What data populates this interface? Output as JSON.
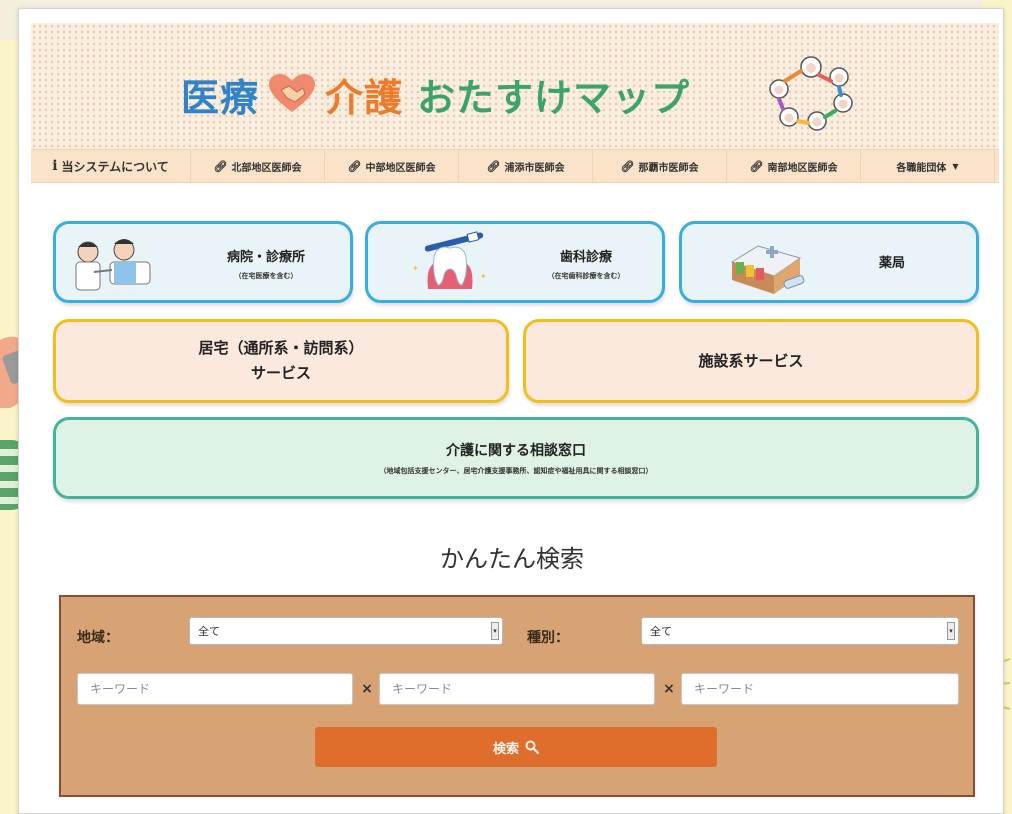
{
  "header": {
    "title_part1": "医療",
    "title_part2": "介護",
    "title_part3": "おたすけマップ"
  },
  "nav": {
    "about": "当システムについて",
    "associations": [
      "北部地区医師会",
      "中部地区医師会",
      "浦添市医師会",
      "那覇市医師会",
      "南部地区医師会"
    ],
    "dropdown": "各職能団体"
  },
  "cards": {
    "hospital": {
      "title": "病院・診療所",
      "sub": "（在宅医療を含む）"
    },
    "dental": {
      "title": "歯科診療",
      "sub": "（在宅歯科診療を含む）"
    },
    "pharmacy": {
      "title": "薬局"
    },
    "home_care": {
      "line1": "居宅（通所系・訪問系）",
      "line2": "サービス"
    },
    "facility": {
      "title": "施設系サービス"
    },
    "consult": {
      "title": "介護に関する相談窓口",
      "sub": "（地域包括支援センター、居宅介護支援事務所、認知症や福祉用具に関する相談窓口）"
    }
  },
  "search": {
    "heading": "かんたん検索",
    "region_label": "地域：",
    "region_value": "全て",
    "type_label": "種別：",
    "type_value": "全て",
    "keyword_placeholder": "キーワード",
    "button_label": "検索"
  },
  "colors": {
    "blue_border": "#35aee3",
    "yellow_border": "#f1bf1c",
    "green_border": "#43b39a",
    "search_panel": "#d8a374",
    "search_button": "#df6e2c"
  }
}
